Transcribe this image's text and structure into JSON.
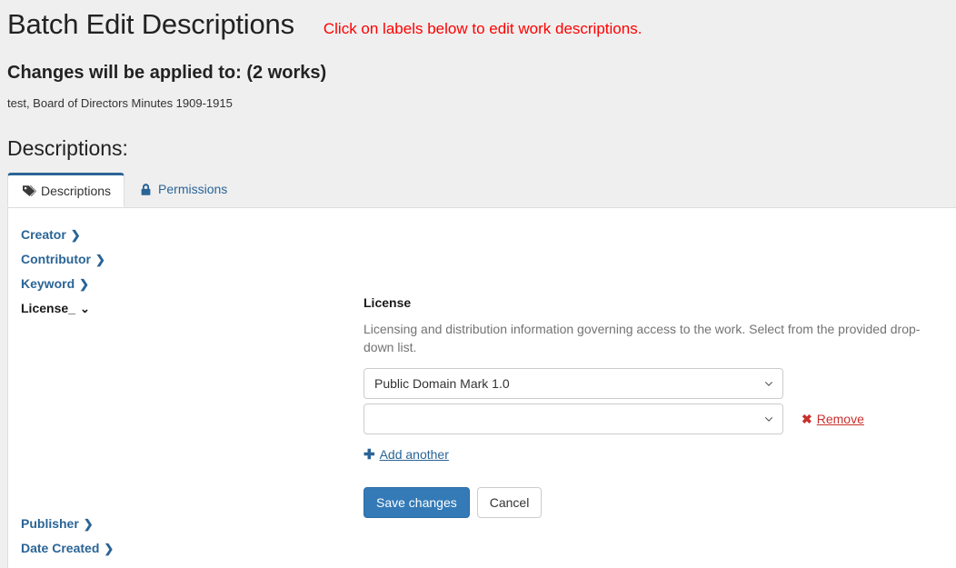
{
  "header": {
    "title": "Batch Edit Descriptions",
    "hint": "Click on labels below to edit work descriptions.",
    "applied_to": "Changes will be applied to: (2 works)",
    "works": "test, Board of Directors Minutes 1909-1915",
    "section_label": "Descriptions:"
  },
  "tabs": [
    {
      "label": "Descriptions",
      "icon": "tag-icon",
      "active": true
    },
    {
      "label": "Permissions",
      "icon": "lock-icon",
      "active": false
    }
  ],
  "fields_top": [
    {
      "label": "Creator",
      "chevron": "❯",
      "active": false
    },
    {
      "label": "Contributor",
      "chevron": "❯",
      "active": false
    },
    {
      "label": "Keyword",
      "chevron": "❯",
      "active": false
    },
    {
      "label": "License_",
      "chevron": "⌄",
      "active": true
    }
  ],
  "fields_bottom": [
    {
      "label": "Publisher",
      "chevron": "❯",
      "active": false
    },
    {
      "label": "Date Created",
      "chevron": "❯",
      "active": false
    }
  ],
  "detail": {
    "title": "License",
    "help": "Licensing and distribution information governing access to the work. Select from the provided drop-down list.",
    "selects": [
      {
        "value": "Public Domain Mark 1.0",
        "has_remove": false
      },
      {
        "value": "",
        "has_remove": true
      }
    ],
    "remove_label": "Remove",
    "add_another_label": "Add another",
    "save_label": "Save changes",
    "cancel_label": "Cancel"
  },
  "colors": {
    "background": "#efefef",
    "panel": "#ffffff",
    "link": "#2a6496",
    "primary": "#337ab7",
    "danger": "#c9302c",
    "hint_red": "#ff0000"
  }
}
